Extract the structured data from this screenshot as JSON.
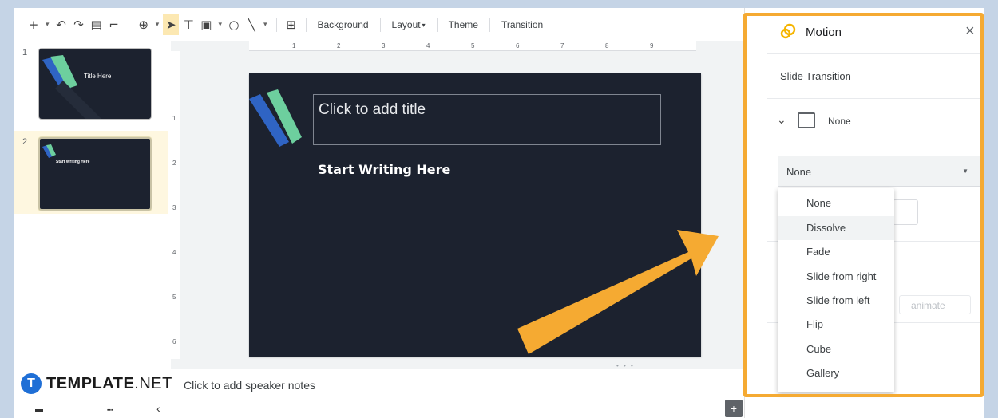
{
  "toolbar": {
    "items": [
      {
        "name": "new-slide-icon",
        "glyph": "+"
      },
      {
        "name": "new-slide-dropdown-icon",
        "glyph": "▾"
      },
      {
        "name": "undo-icon",
        "glyph": "↶"
      },
      {
        "name": "redo-icon",
        "glyph": "↷"
      },
      {
        "name": "print-icon",
        "glyph": "▤"
      },
      {
        "name": "paint-format-icon",
        "glyph": "⌐"
      },
      {
        "name": "zoom-icon",
        "glyph": "⊕"
      },
      {
        "name": "zoom-dropdown-icon",
        "glyph": "▾"
      },
      {
        "name": "select-cursor-icon",
        "glyph": "➤"
      },
      {
        "name": "text-box-icon",
        "glyph": "⊤"
      },
      {
        "name": "image-icon",
        "glyph": "▣"
      },
      {
        "name": "image-dropdown-icon",
        "glyph": "▾"
      },
      {
        "name": "shape-icon",
        "glyph": "○"
      },
      {
        "name": "line-icon",
        "glyph": "╲"
      },
      {
        "name": "line-dropdown-icon",
        "glyph": "▾"
      },
      {
        "name": "comment-icon",
        "glyph": "⊞"
      }
    ],
    "background_label": "Background",
    "layout_label": "Layout",
    "layout_arrow": "▾",
    "theme_label": "Theme",
    "transition_label": "Transition",
    "collapse_glyph": "︿"
  },
  "filmstrip": {
    "slides": [
      {
        "number": "1",
        "title": "Title Here"
      },
      {
        "number": "2",
        "title": "Start Writing Here"
      }
    ]
  },
  "ruler": {
    "h_numbers": [
      "1",
      "2",
      "3",
      "4",
      "5",
      "6",
      "7",
      "8",
      "9"
    ],
    "v_numbers": [
      "1",
      "2",
      "3",
      "4",
      "5",
      "6"
    ]
  },
  "slide": {
    "title_placeholder": "Click to add title",
    "body": "Start Writing Here",
    "accent_blue": "#2f64c4",
    "accent_green": "#6dcf9e",
    "background": "#1c222f"
  },
  "notes": {
    "placeholder": "Click to add speaker notes"
  },
  "brand": {
    "logo_letter": "T",
    "name_bold": "TEMPLATE",
    "name_regular": ".NET"
  },
  "bottom_icons": {
    "grid_view": "▬",
    "filmstrip_view": "▪▪▪",
    "collapse": "‹"
  },
  "add_button": "+",
  "panel": {
    "title": "Motion",
    "close": "×",
    "section": "Slide Transition",
    "chevron": "⌄",
    "current_transition": "None",
    "select_value": "None",
    "select_arrow": "▼",
    "animate_label": "animate",
    "options": [
      "None",
      "Dissolve",
      "Fade",
      "Slide from right",
      "Slide from left",
      "Flip",
      "Cube",
      "Gallery"
    ],
    "hovered_option": "Dissolve",
    "highlight_color": "#f5aa32"
  }
}
